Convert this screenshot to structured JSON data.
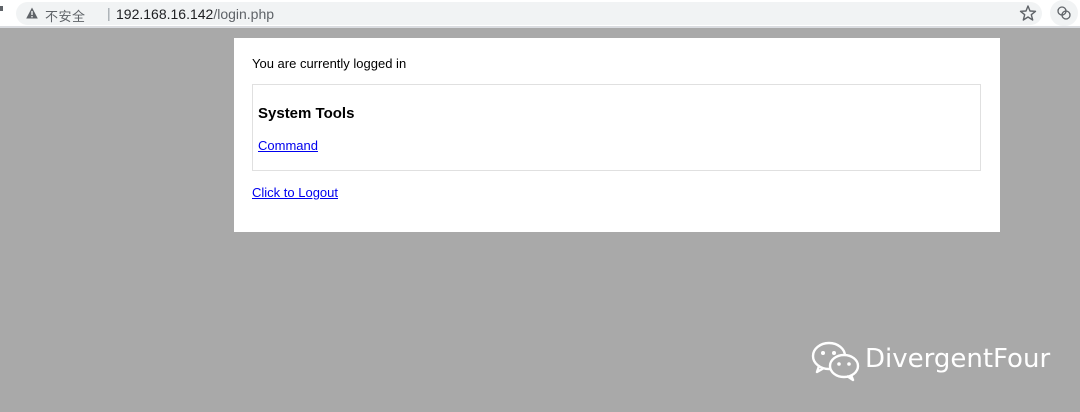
{
  "browser": {
    "security_label": "不安全",
    "separator": "|",
    "url_host": "192.168.16.142",
    "url_path": "/login.php",
    "icons": [
      "warning-icon",
      "star-icon",
      "extension-icon"
    ]
  },
  "page": {
    "status_text": "You are currently logged in",
    "tools_heading": "System Tools",
    "command_link": "Command",
    "logout_link": "Click to Logout"
  },
  "watermark": {
    "text": "DivergentFour",
    "icon": "wechat-icon"
  },
  "colors": {
    "background": "#a9a9a9",
    "link": "#0000ee",
    "card": "#ffffff"
  }
}
